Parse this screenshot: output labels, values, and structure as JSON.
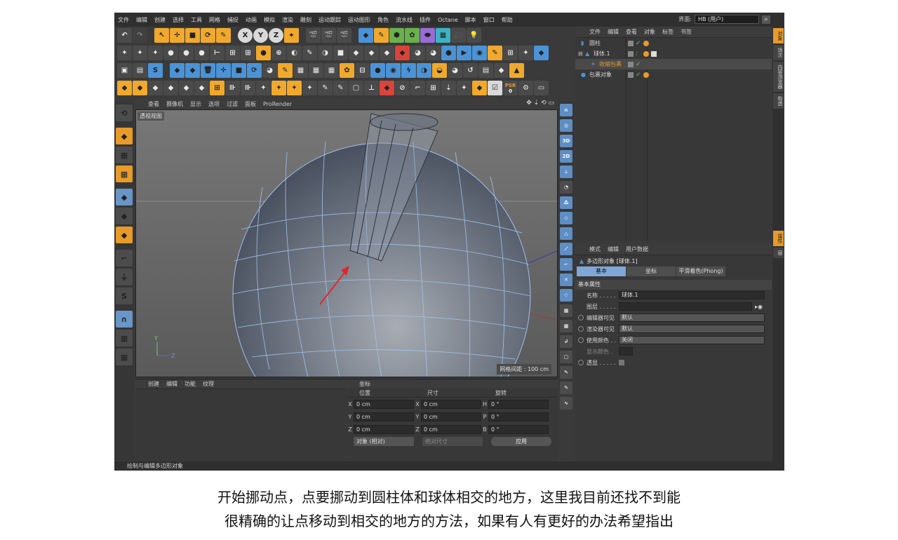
{
  "menubar": {
    "items": [
      "文件",
      "编辑",
      "创建",
      "选择",
      "工具",
      "网格",
      "捕捉",
      "动画",
      "模拟",
      "渲染",
      "雕刻",
      "运动跟踪",
      "运动图形",
      "角色",
      "流水线",
      "插件",
      "Octane",
      "脚本",
      "窗口",
      "帮助"
    ],
    "layout_label": "界面:",
    "layout_value": "HB (用户)"
  },
  "toolbar": {
    "xyz": [
      "X",
      "Y",
      "Z"
    ],
    "psr": "PSR",
    "psr_value": "0"
  },
  "viewport": {
    "menu": [
      "查看",
      "摄像机",
      "显示",
      "选项",
      "过滤",
      "面板",
      "ProRender"
    ],
    "view_label": "透视视图",
    "grid_label": "网格间距 : 100 cm",
    "axis_y": "Y",
    "axis_z": "Z"
  },
  "material_panel": {
    "menu": [
      "创建",
      "编辑",
      "功能",
      "纹理"
    ]
  },
  "coord_panel": {
    "title": "坐标",
    "headers": [
      "位置",
      "尺寸",
      "旋转"
    ],
    "rows": [
      {
        "pa": "X",
        "pv": "0 cm",
        "sa": "X",
        "sv": "0 cm",
        "ra": "H",
        "rv": "0 °"
      },
      {
        "pa": "Y",
        "pv": "0 cm",
        "sa": "Y",
        "sv": "0 cm",
        "ra": "P",
        "rv": "0 °"
      },
      {
        "pa": "Z",
        "pv": "0 cm",
        "sa": "Z",
        "sv": "0 cm",
        "ra": "B",
        "rv": "0 °"
      }
    ],
    "mode": "对象 (相对)",
    "size_mode": "绝对尺寸",
    "apply": "应用"
  },
  "status_bar": "绘制与编辑多边形对象",
  "object_panel": {
    "menu": [
      "文件",
      "编辑",
      "查看",
      "对象",
      "标签",
      "书签"
    ],
    "objects": [
      {
        "name": "圆柱",
        "color": "#d6d6d6"
      },
      {
        "name": "球体.1",
        "color": "#d6d6d6"
      },
      {
        "name": "收缩包裹",
        "color": "#e79b2a"
      },
      {
        "name": "包裹对象",
        "color": "#d6d6d6"
      }
    ]
  },
  "side_tabs": [
    "对象",
    "场次",
    "内容浏览器",
    "构造"
  ],
  "side_tabs_attr": [
    "属性",
    "层"
  ],
  "attr_panel": {
    "menu": [
      "模式",
      "编辑",
      "用户数据"
    ],
    "title": "多边形对象 [球体.1]",
    "tabs": [
      "基本",
      "坐标",
      "平滑着色(Phong)"
    ],
    "section": "基本属性",
    "rows": [
      {
        "label": "名称 . . . . .",
        "value": "球体.1"
      },
      {
        "label": "图层 . . . . .",
        "value": ""
      },
      {
        "label": "编辑器可见",
        "value": "默认"
      },
      {
        "label": "渲染器可见",
        "value": "默认"
      },
      {
        "label": "使用颜色 . .",
        "value": "关闭"
      },
      {
        "label": "显示颜色 .",
        "value": ""
      },
      {
        "label": "透显 . . . . .",
        "value": ""
      }
    ]
  },
  "caption": {
    "line1": "开始挪动点，点要挪动到圆柱体和球体相交的地方，这里我目前还找不到能",
    "line2": "很精确的让点移动到相交的地方的方法，如果有人有更好的办法希望指出"
  },
  "colors": {
    "accent": "#e79b2a",
    "selection": "#7fa8d8",
    "arrow": "#e0262c",
    "wire": "#9ec4ee"
  }
}
